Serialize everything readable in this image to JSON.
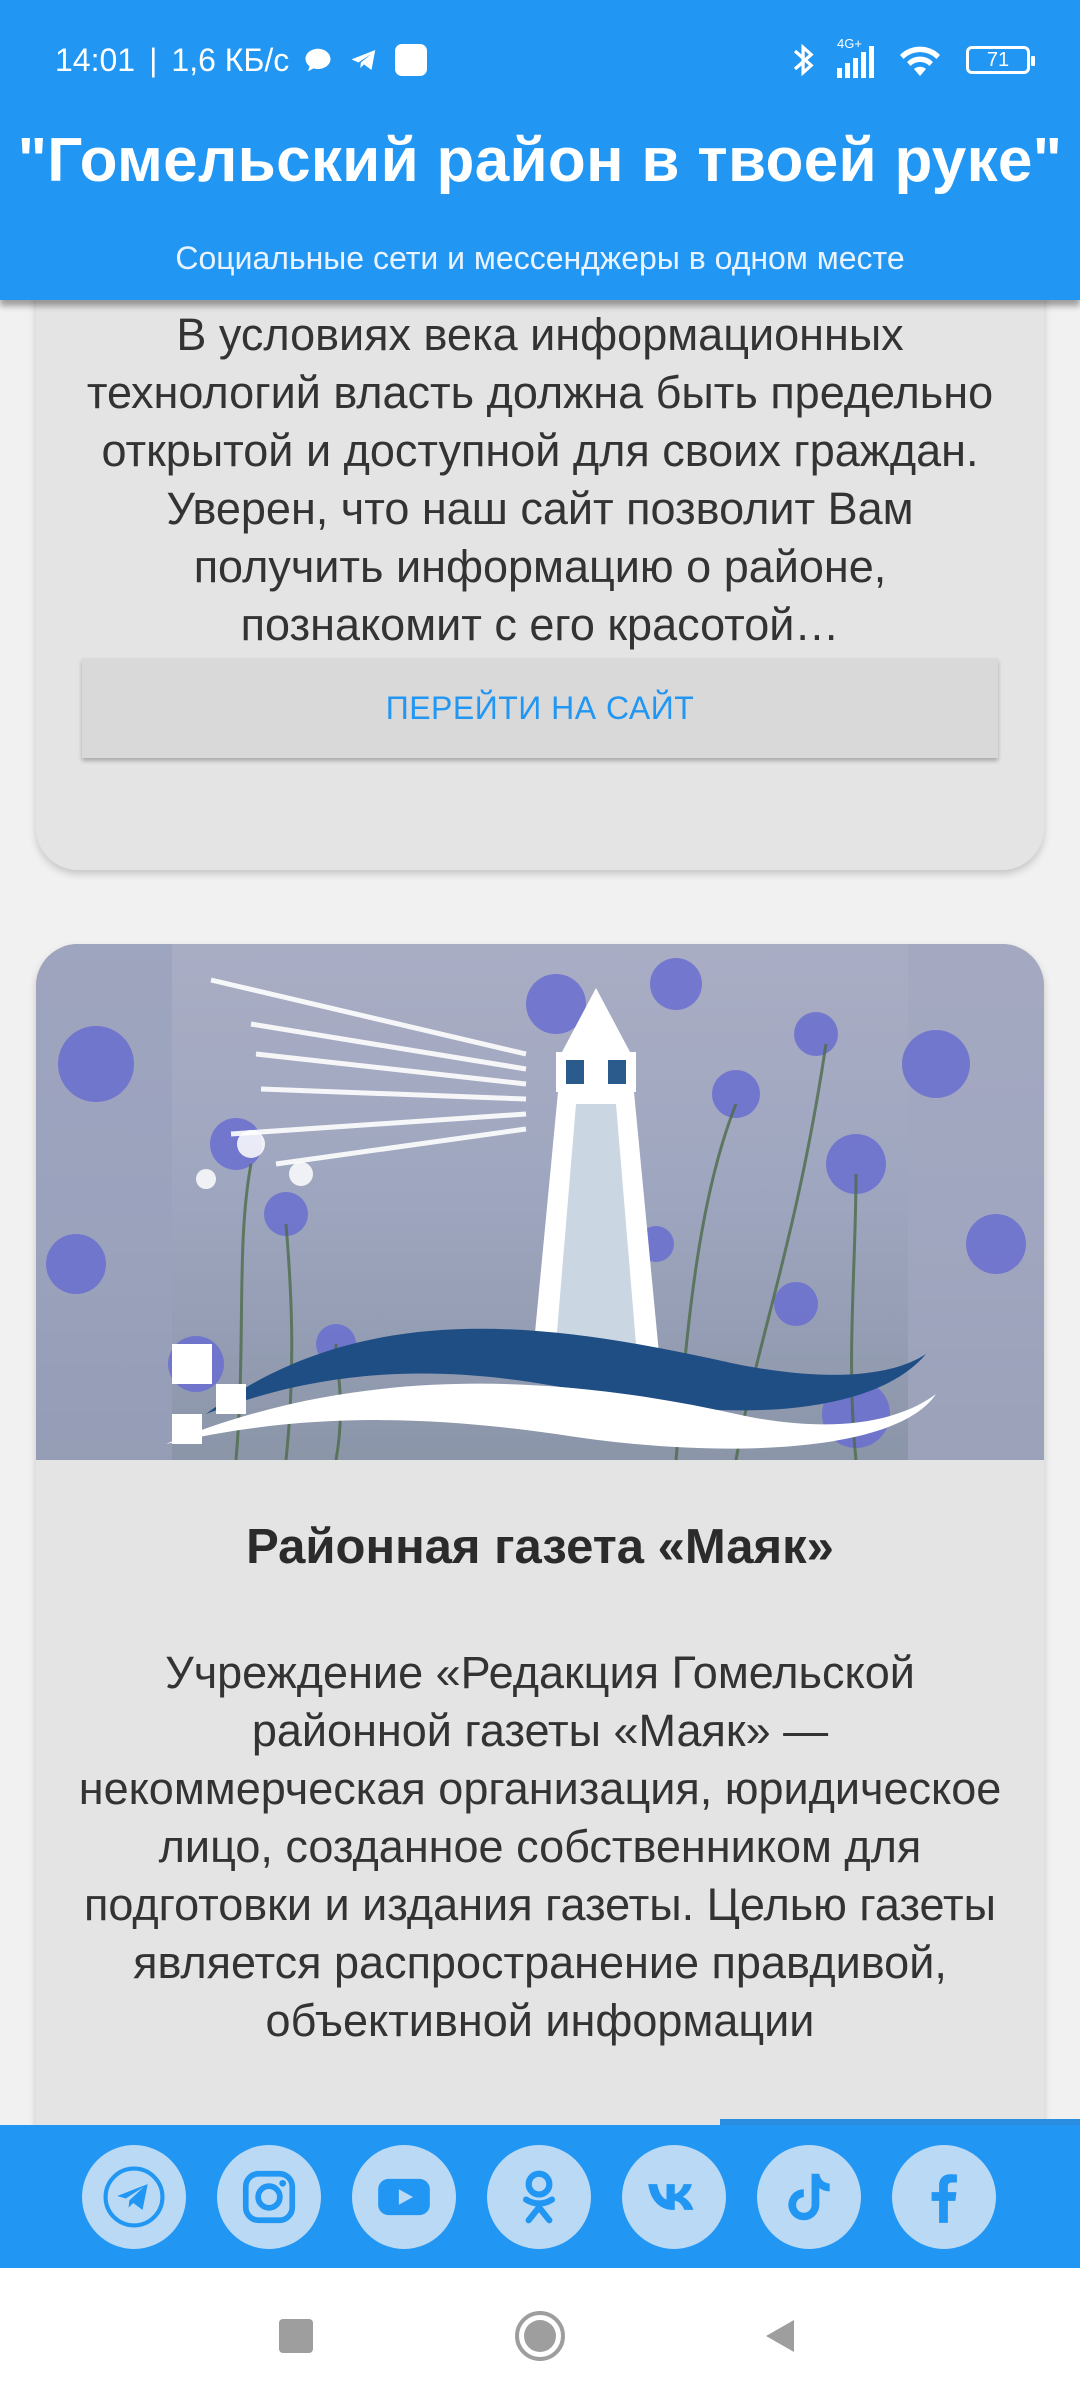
{
  "status_bar": {
    "time": "14:01",
    "speed": "1,6 КБ/с",
    "network": "4G+",
    "battery": "71"
  },
  "header": {
    "title": "\"Гомельский район в твоей руке\"",
    "subtitle": "Социальные сети и мессенджеры в одном месте"
  },
  "cards": [
    {
      "description": "В условиях века информационных технологий власть должна быть предельно открытой и доступной для своих граждан. Уверен, что наш сайт позволит Вам получить информацию о районе, познакомит с его красотой…",
      "button_label": "ПЕРЕЙТИ НА САЙТ"
    },
    {
      "title": "Районная газета «Маяк»",
      "description": "Учреждение «Редакция Гомельской районной газеты «Маяк» — некоммерческая организация, юридическое лицо, созданное собственником для подготовки и издания газеты. Целью газеты является распространение правдивой, объективной информации"
    }
  ],
  "social": [
    {
      "name": "telegram-icon"
    },
    {
      "name": "instagram-icon"
    },
    {
      "name": "youtube-icon"
    },
    {
      "name": "odnoklassniki-icon"
    },
    {
      "name": "vk-icon"
    },
    {
      "name": "tiktok-icon"
    },
    {
      "name": "facebook-icon"
    }
  ],
  "colors": {
    "accent": "#2196f3",
    "social_button": "#b9d9f5",
    "card": "#e4e4e4"
  }
}
